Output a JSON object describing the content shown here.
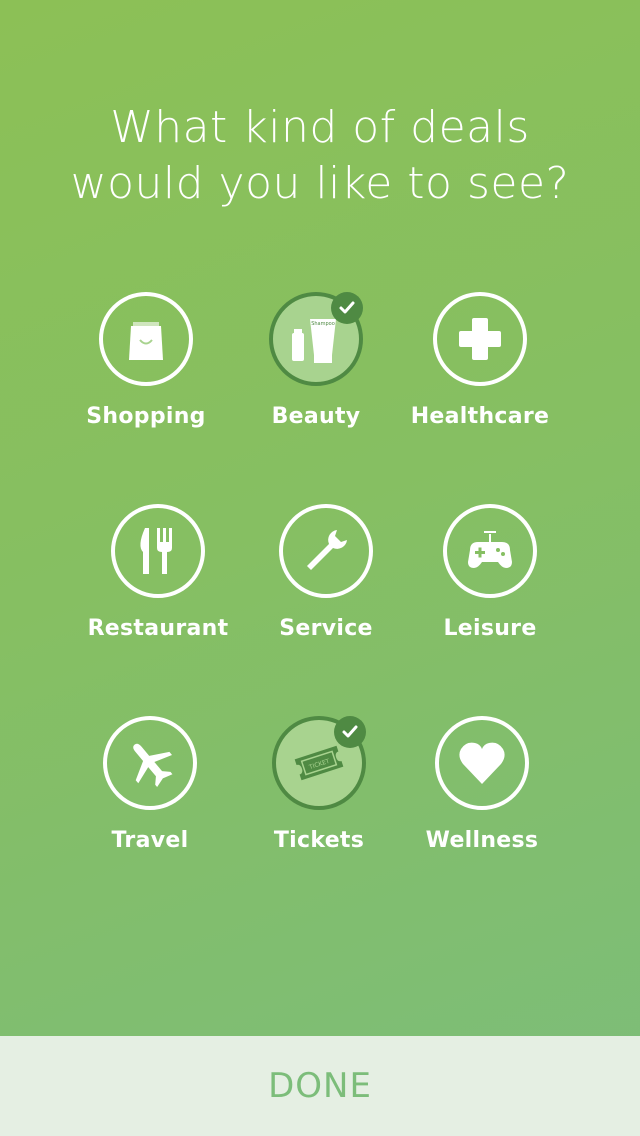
{
  "title": {
    "line1": "What kind of deals",
    "line2": "would you like to see?"
  },
  "categories": [
    {
      "label": "Shopping",
      "icon": "shopping-bag-icon",
      "selected": false
    },
    {
      "label": "Beauty",
      "icon": "beauty-products-icon",
      "selected": true
    },
    {
      "label": "Healthcare",
      "icon": "cross-icon",
      "selected": false
    },
    {
      "label": "Restaurant",
      "icon": "knife-fork-icon",
      "selected": false
    },
    {
      "label": "Service",
      "icon": "wrench-icon",
      "selected": false
    },
    {
      "label": "Leisure",
      "icon": "gamepad-icon",
      "selected": false
    },
    {
      "label": "Travel",
      "icon": "airplane-icon",
      "selected": false
    },
    {
      "label": "Tickets",
      "icon": "ticket-icon",
      "selected": true
    },
    {
      "label": "Wellness",
      "icon": "heart-icon",
      "selected": false
    }
  ],
  "icon_text": {
    "beauty_tube": "Shampoo",
    "ticket": "TICKET"
  },
  "done": {
    "label": "DONE"
  },
  "colors": {
    "gradient_top": "#8cc056",
    "gradient_bottom": "#7cbd7a",
    "selected_fill": "#a8d38f",
    "selected_ring": "#4f8a43",
    "done_bar": "#e5efe3",
    "done_text": "#7cbd7a"
  }
}
